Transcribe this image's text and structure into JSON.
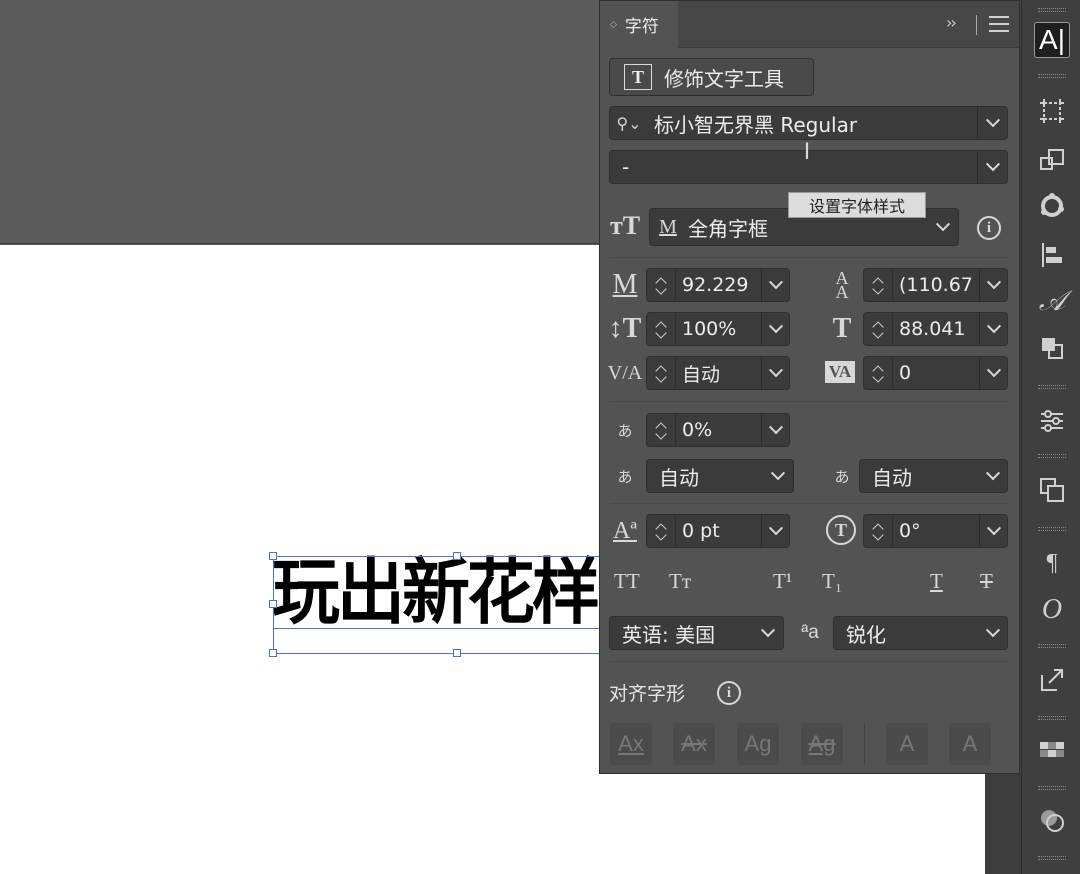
{
  "canvas": {
    "artboard_text": "玩出新花样"
  },
  "panel": {
    "tab_label": "字符",
    "tab_arrows": "◇",
    "collapse_glyph": "››",
    "trim_type_tool_label": "修饰文字工具",
    "font_family": "标小智无界黑 Regular",
    "font_style": "-",
    "tooltip": "设置字体样式",
    "frame_option": "全角字框",
    "font_size": "92.229",
    "leading": "(110.67",
    "vertical_scale": "100%",
    "horizontal_scale": "88.041",
    "kerning": "自动",
    "tracking": "0",
    "tsume": "0%",
    "aki_left": "自动",
    "aki_right": "自动",
    "baseline_shift": "0 pt",
    "rotation": "0°",
    "caps_buttons": [
      "TT",
      "Tт",
      "T¹",
      "T₁",
      "T",
      "T"
    ],
    "language": "英语: 美国",
    "antialias": "锐化",
    "aa_icon": "ªa",
    "snap_to_glyph_label": "对齐字形",
    "snap_buttons": [
      "Ax",
      "Ax",
      "Ag",
      "Ag",
      "A",
      "A"
    ]
  },
  "toolbar": {
    "type_tool_glyph": "A|",
    "glyphs": [
      "¶",
      "O"
    ]
  }
}
